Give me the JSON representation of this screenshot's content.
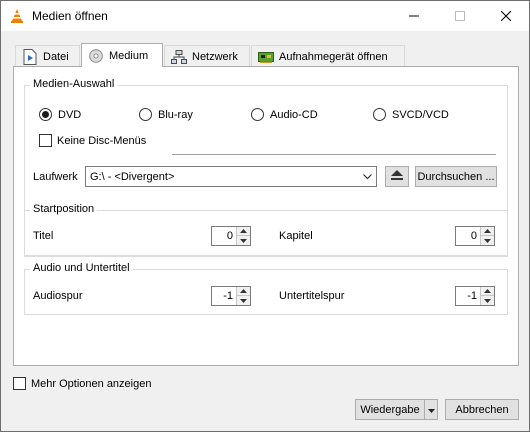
{
  "window": {
    "title": "Medien öffnen",
    "icon": "vlc-cone-icon",
    "controls": [
      "minimize-icon",
      "maximize-icon",
      "close-icon"
    ]
  },
  "tabs": [
    {
      "label": "Datei",
      "icon": "file-play-icon",
      "active": false
    },
    {
      "label": "Medium",
      "icon": "disc-icon",
      "active": true
    },
    {
      "label": "Netzwerk",
      "icon": "network-icon",
      "active": false
    },
    {
      "label": "Aufnahmegerät öffnen",
      "icon": "capture-card-icon",
      "active": false
    }
  ],
  "media_selection": {
    "title": "Medien-Auswahl",
    "options": [
      {
        "label": "DVD",
        "selected": true
      },
      {
        "label": "Blu-ray",
        "selected": false
      },
      {
        "label": "Audio-CD",
        "selected": false
      },
      {
        "label": "SVCD/VCD",
        "selected": false
      }
    ],
    "no_disc_menus": {
      "label": "Keine Disc-Menüs",
      "checked": false
    },
    "drive_label": "Laufwerk",
    "drive_value": "G:\\ - <Divergent>",
    "browse_label": "Durchsuchen ..."
  },
  "start_position": {
    "title": "Startposition",
    "title_label": "Titel",
    "title_value": "0",
    "chapter_label": "Kapitel",
    "chapter_value": "0"
  },
  "audio_subtitles": {
    "title": "Audio und Untertitel",
    "audio_label": "Audiospur",
    "audio_value": "-1",
    "subtitle_label": "Untertitelspur",
    "subtitle_value": "-1"
  },
  "footer": {
    "more_options": {
      "label": "Mehr Optionen anzeigen",
      "checked": false
    },
    "play_label": "Wiedergabe",
    "cancel_label": "Abbrechen"
  },
  "colors": {
    "accent_vlc": "#f08000",
    "window_bg": "#f0f0f0",
    "panel_bg": "#ffffff"
  }
}
